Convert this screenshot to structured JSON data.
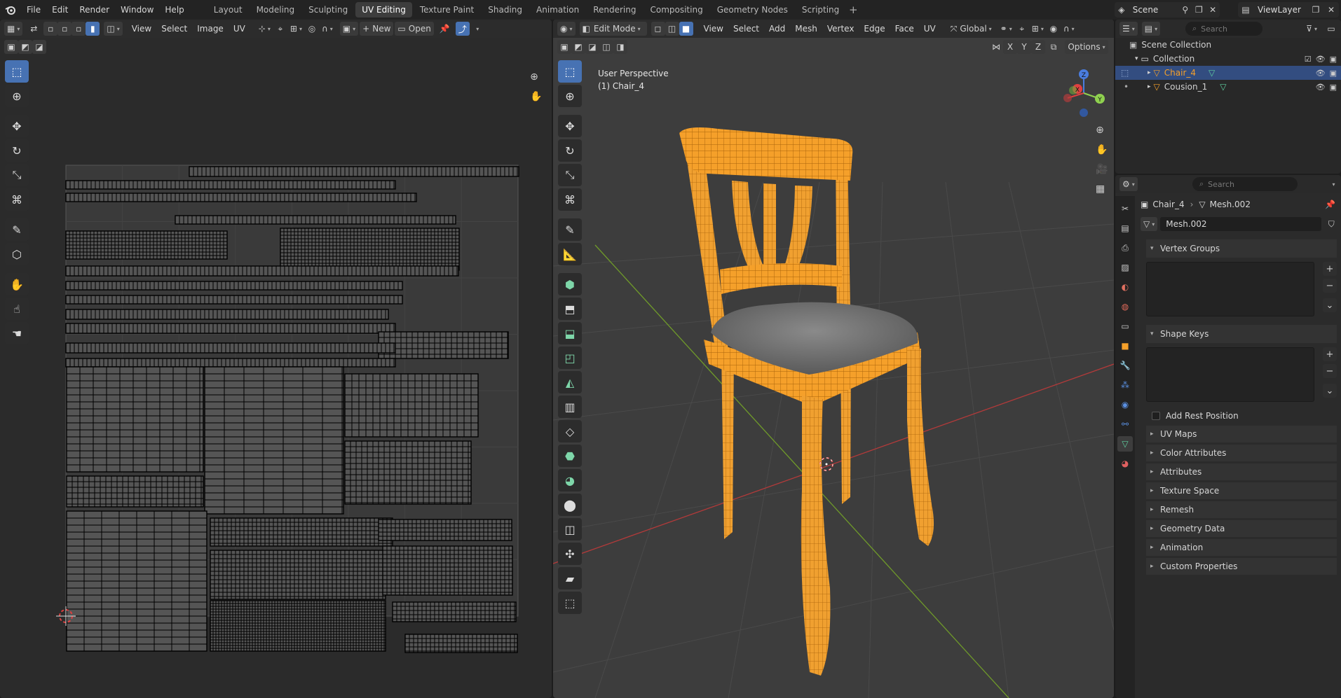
{
  "topbar": {
    "menus": [
      "File",
      "Edit",
      "Render",
      "Window",
      "Help"
    ],
    "workspaces": [
      "Layout",
      "Modeling",
      "Sculpting",
      "UV Editing",
      "Texture Paint",
      "Shading",
      "Animation",
      "Rendering",
      "Compositing",
      "Geometry Nodes",
      "Scripting"
    ],
    "active_workspace": "UV Editing",
    "scene": "Scene",
    "view_layer": "ViewLayer"
  },
  "uv_editor": {
    "menus": [
      "View",
      "Select",
      "Image",
      "UV"
    ],
    "new_label": "New",
    "open_label": "Open"
  },
  "viewport": {
    "mode": "Edit Mode",
    "menus": [
      "View",
      "Select",
      "Add",
      "Mesh",
      "Vertex",
      "Edge",
      "Face",
      "UV"
    ],
    "orientation": "Global",
    "axes": [
      "X",
      "Y",
      "Z"
    ],
    "options_label": "Options",
    "perspective_label": "User Perspective",
    "object_label": "(1) Chair_4",
    "gizmo": {
      "x": "X",
      "y": "Y",
      "z": "Z"
    }
  },
  "outliner": {
    "search_placeholder": "Search",
    "root": "Scene Collection",
    "collection": "Collection",
    "objects": [
      {
        "name": "Chair_4",
        "selected": true
      },
      {
        "name": "Cousion_1",
        "selected": false
      }
    ]
  },
  "properties": {
    "search_placeholder": "Search",
    "breadcrumb": [
      "Chair_4",
      "Mesh.002"
    ],
    "mesh_name": "Mesh.002",
    "panels_open": [
      "Vertex Groups",
      "Shape Keys"
    ],
    "add_rest_position": "Add Rest Position",
    "panels_closed": [
      "UV Maps",
      "Color Attributes",
      "Attributes",
      "Texture Space",
      "Remesh",
      "Geometry Data",
      "Animation",
      "Custom Properties"
    ]
  },
  "colors": {
    "accent": "#4772b3",
    "selection_orange": "#f5a02a",
    "axis_red": "#b33a3a",
    "axis_green": "#6f9a2a"
  }
}
